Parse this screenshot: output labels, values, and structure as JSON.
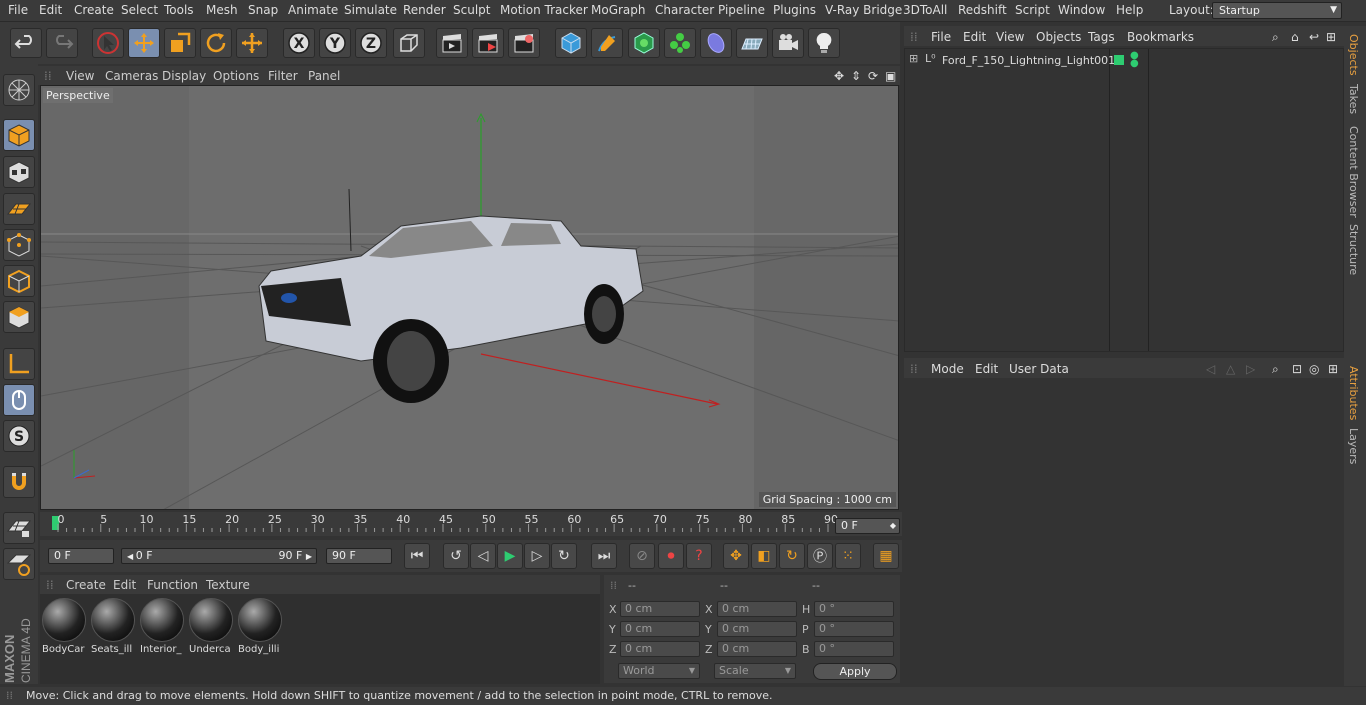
{
  "menubar": {
    "items": [
      "File",
      "Edit",
      "Create",
      "Select",
      "Tools",
      "Mesh",
      "Snap",
      "Animate",
      "Simulate",
      "Render",
      "Sculpt",
      "Motion Tracker",
      "MoGraph",
      "Character",
      "Pipeline",
      "Plugins",
      "V-Ray Bridge",
      "3DToAll",
      "Redshift",
      "Script",
      "Window",
      "Help"
    ],
    "layout_label": "Layout:",
    "layout_value": "Startup"
  },
  "viewport": {
    "menu": [
      "View",
      "Cameras",
      "Display",
      "Options",
      "Filter",
      "Panel"
    ],
    "camera_label": "Perspective",
    "grid_spacing": "Grid Spacing : 1000 cm"
  },
  "timeline": {
    "ticks": [
      "0",
      "5",
      "10",
      "15",
      "20",
      "25",
      "30",
      "35",
      "40",
      "45",
      "50",
      "55",
      "60",
      "65",
      "70",
      "75",
      "80",
      "85",
      "90"
    ],
    "current_frame": "0 F"
  },
  "transport": {
    "start_field": "0 F",
    "range_start": "0 F",
    "range_end": "90 F",
    "end_field": "90 F"
  },
  "materials": {
    "menu": [
      "Create",
      "Edit",
      "Function",
      "Texture"
    ],
    "items": [
      "BodyCar",
      "Seats_ill",
      "Interior_",
      "Underca",
      "Body_illi"
    ]
  },
  "coordinates": {
    "headers": [
      "--",
      "--",
      "--"
    ],
    "rows": [
      {
        "a": "X",
        "av": "0 cm",
        "b": "X",
        "bv": "0 cm",
        "c": "H",
        "cv": "0 °"
      },
      {
        "a": "Y",
        "av": "0 cm",
        "b": "Y",
        "bv": "0 cm",
        "c": "P",
        "cv": "0 °"
      },
      {
        "a": "Z",
        "av": "0 cm",
        "b": "Z",
        "bv": "0 cm",
        "c": "B",
        "cv": "0 °"
      }
    ],
    "world": "World",
    "scale": "Scale",
    "apply": "Apply"
  },
  "objects": {
    "menu": [
      "File",
      "Edit",
      "View",
      "Objects",
      "Tags",
      "Bookmarks"
    ],
    "items": [
      {
        "name": "Ford_F_150_Lightning_Light001"
      }
    ]
  },
  "attributes": {
    "menu": [
      "Mode",
      "Edit",
      "User Data"
    ]
  },
  "right_tabs": [
    "Objects",
    "Takes",
    "Content Browser",
    "Structure",
    "Attributes",
    "Layers"
  ],
  "status": "Move: Click and drag to move elements. Hold down SHIFT to quantize movement / add to the selection in point mode, CTRL to remove.",
  "brand": {
    "line1": "MAXON",
    "line2": "CINEMA 4D"
  },
  "colors": {
    "accent": "#7a8fb0",
    "active_tab": "#e8a040",
    "tag_green": "#2ecc71"
  }
}
